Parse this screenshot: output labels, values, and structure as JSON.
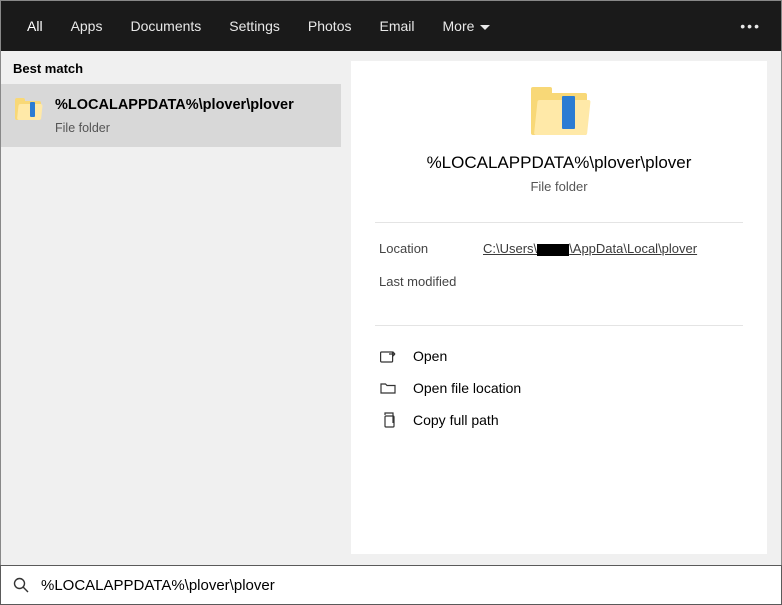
{
  "topbar": {
    "tabs": [
      "All",
      "Apps",
      "Documents",
      "Settings",
      "Photos",
      "Email"
    ],
    "more": "More",
    "activeIndex": 0
  },
  "left": {
    "section": "Best match",
    "result": {
      "title": "%LOCALAPPDATA%\\plover\\plover",
      "subtitle": "File folder"
    }
  },
  "detail": {
    "title": "%LOCALAPPDATA%\\plover\\plover",
    "subtitle": "File folder",
    "meta": {
      "location_label": "Location",
      "location_prefix": "C:\\Users\\",
      "location_suffix": "\\AppData\\Local\\plover",
      "modified_label": "Last modified",
      "modified_value": ""
    },
    "actions": {
      "open": "Open",
      "open_location": "Open file location",
      "copy_path": "Copy full path"
    }
  },
  "search": {
    "value": "%LOCALAPPDATA%\\plover\\plover"
  }
}
